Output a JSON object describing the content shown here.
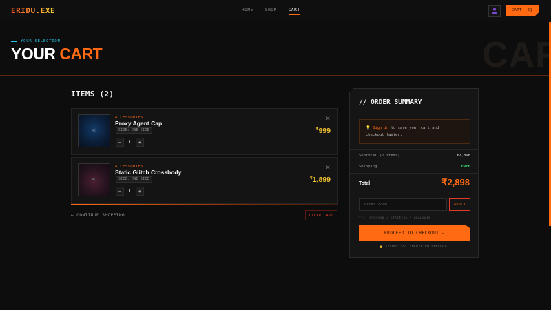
{
  "header": {
    "logo": "ERIDU.EXE",
    "nav": [
      {
        "label": "HOME",
        "active": false
      },
      {
        "label": "SHOP",
        "active": false
      },
      {
        "label": "CART",
        "active": true
      }
    ],
    "cart_button": "CART [2]",
    "user_icon": "user-icon"
  },
  "hero": {
    "eyebrow": "YOUR SELECTION",
    "title_main": "YOUR ",
    "title_accent": "CART",
    "background_word": "CART"
  },
  "items_section": {
    "heading": "ITEMS (2)",
    "items": [
      {
        "category": "ACCESSORIES",
        "name": "Proxy Agent Cap",
        "size": "SIZE: ONE SIZE",
        "quantity": "1",
        "price_currency": "₹",
        "price": "999",
        "thumb_label": "AC"
      },
      {
        "category": "ACCESSORIES",
        "name": "Static Glitch Crossbody",
        "size": "SIZE: ONE SIZE",
        "quantity": "1",
        "price_currency": "₹",
        "price": "1,899",
        "thumb_label": "AC"
      }
    ],
    "continue_link": "← CONTINUE SHOPPING",
    "clear_button": "CLEAR CART"
  },
  "summary": {
    "title": "// ORDER SUMMARY",
    "signin_link": "Sign in",
    "signin_text_line1": " to save your cart and",
    "signin_text_line2": "checkout faster.",
    "subtotal_label": "Subtotal (2 items)",
    "subtotal_value": "₹2,898",
    "shipping_label": "Shipping",
    "shipping_value": "FREE",
    "total_label": "Total",
    "total_value": "₹2,898",
    "promo_placeholder": "Promo code",
    "apply_button": "APPLY",
    "promo_hint": "Try: PROXY10 / STATIC20 / HOLLOW15",
    "checkout_button": "PROCEED TO CHECKOUT →",
    "secure_note": "SECURE SSL ENCRYPTED CHECKOUT"
  },
  "colors": {
    "accent": "#ff6a13",
    "price": "#f4c430",
    "free": "#34d26b",
    "eyebrow": "#29c6e8",
    "background": "#0d0d0d"
  }
}
